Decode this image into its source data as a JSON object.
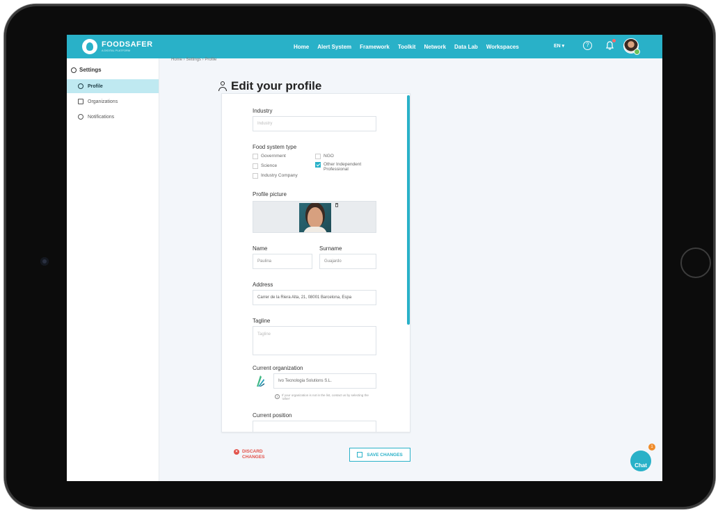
{
  "brand": {
    "name": "FOODSAFER",
    "tagline": "A DIGITAL PLATFORM"
  },
  "nav": {
    "items": [
      "Home",
      "Alert System",
      "Framework",
      "Toolkit",
      "Network",
      "Data Lab",
      "Workspaces"
    ],
    "language": "EN ▾"
  },
  "sidebar": {
    "title": "Settings",
    "items": [
      {
        "label": "Profile",
        "icon": "user-icon",
        "active": true
      },
      {
        "label": "Organizations",
        "icon": "building-icon",
        "active": false
      },
      {
        "label": "Notifications",
        "icon": "bell-icon",
        "active": false
      }
    ]
  },
  "breadcrumb": "Home › Settings › Profile",
  "page": {
    "title": "Edit your profile"
  },
  "form": {
    "industry": {
      "label": "Industry",
      "placeholder": "Industry"
    },
    "food_system_type": {
      "label": "Food system type",
      "options": [
        {
          "label": "Government",
          "checked": false
        },
        {
          "label": "NGO",
          "checked": false
        },
        {
          "label": "Science",
          "checked": false
        },
        {
          "label": "Other Independent Professional",
          "checked": true
        },
        {
          "label": "Industry Company",
          "checked": false
        }
      ]
    },
    "profile_picture": {
      "label": "Profile picture"
    },
    "name": {
      "label": "Name",
      "value": "Paulina"
    },
    "surname": {
      "label": "Surname",
      "value": "Guajardo"
    },
    "address": {
      "label": "Address",
      "value": "Carrer de la Riera Alta, 21, 08001 Barcelona, Espa"
    },
    "tagline": {
      "label": "Tagline",
      "placeholder": "Tagline"
    },
    "current_organization": {
      "label": "Current organization",
      "value": "Ivo Tecnologia Solutions S.L.",
      "info": "If your organization is not in the list, contact us by selecting the 'other'"
    },
    "current_position": {
      "label": "Current position"
    }
  },
  "actions": {
    "discard": "DISCARD CHANGES",
    "save": "SAVE CHANGES"
  },
  "chat": {
    "label": "Chat",
    "badge": "1"
  },
  "colors": {
    "accent": "#29b1c8",
    "danger": "#e2524a",
    "active_bg": "#bfe9f1"
  }
}
